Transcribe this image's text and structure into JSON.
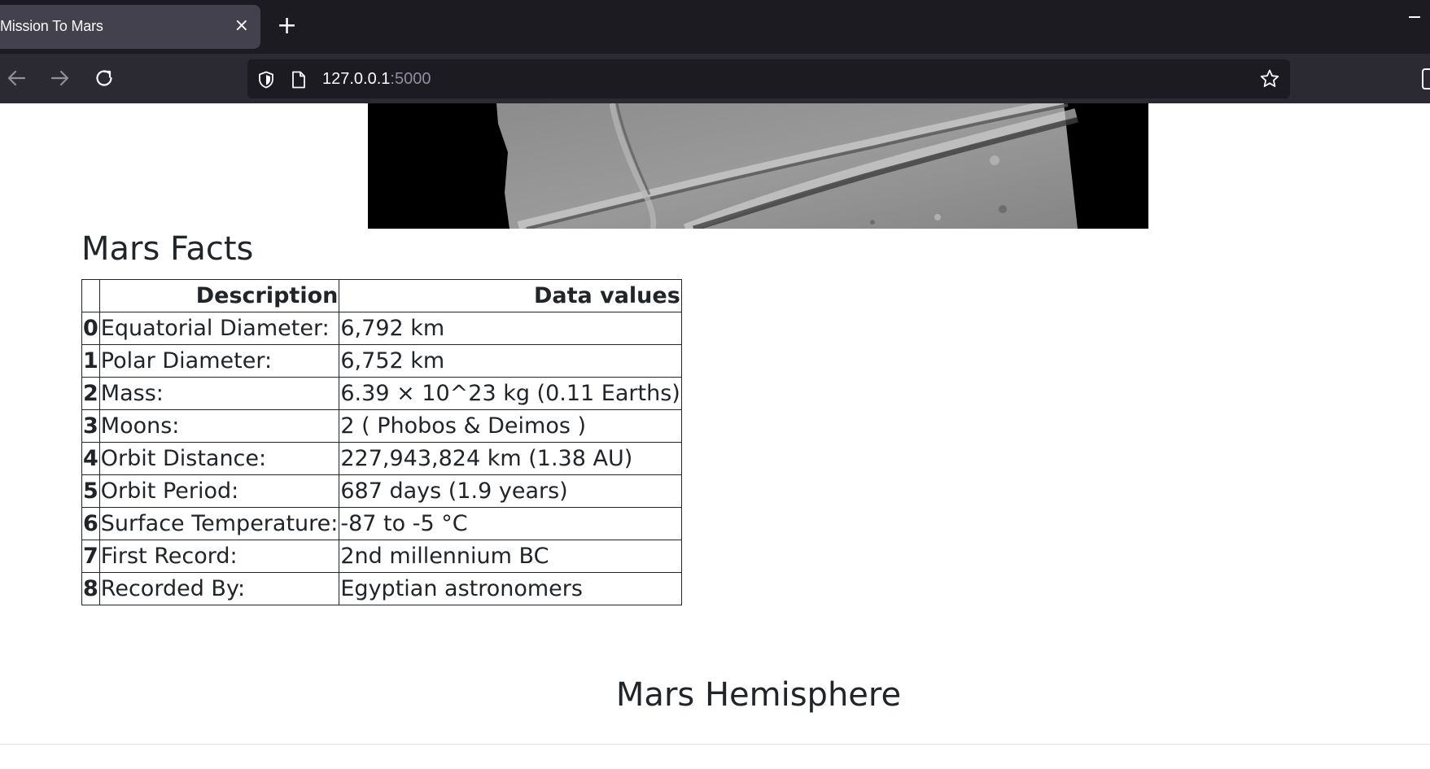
{
  "browser": {
    "tab_title": "Mission To Mars",
    "tab_close": "×",
    "new_tab": "+",
    "url_host": "127.0.0.1",
    "url_port": ":5000"
  },
  "page": {
    "facts_heading": "Mars Facts",
    "hemisphere_heading": "Mars Hemisphere",
    "facts_table": {
      "headers": [
        "",
        "Description",
        "Data values"
      ],
      "rows": [
        {
          "index": "0",
          "description": "Equatorial Diameter:",
          "value": "6,792 km"
        },
        {
          "index": "1",
          "description": "Polar Diameter:",
          "value": "6,752 km"
        },
        {
          "index": "2",
          "description": "Mass:",
          "value": "6.39 × 10^23 kg (0.11 Earths)"
        },
        {
          "index": "3",
          "description": "Moons:",
          "value": "2 ( Phobos & Deimos )"
        },
        {
          "index": "4",
          "description": "Orbit Distance:",
          "value": "227,943,824 km (1.38 AU)"
        },
        {
          "index": "5",
          "description": "Orbit Period:",
          "value": "687 days (1.9 years)"
        },
        {
          "index": "6",
          "description": "Surface Temperature:",
          "value": "-87 to -5 °C"
        },
        {
          "index": "7",
          "description": "First Record:",
          "value": "2nd millennium BC"
        },
        {
          "index": "8",
          "description": "Recorded By:",
          "value": "Egyptian astronomers"
        }
      ]
    }
  },
  "icons": [
    "back-arrow-icon",
    "forward-arrow-icon",
    "reload-icon",
    "shield-icon",
    "page-icon",
    "star-icon"
  ]
}
